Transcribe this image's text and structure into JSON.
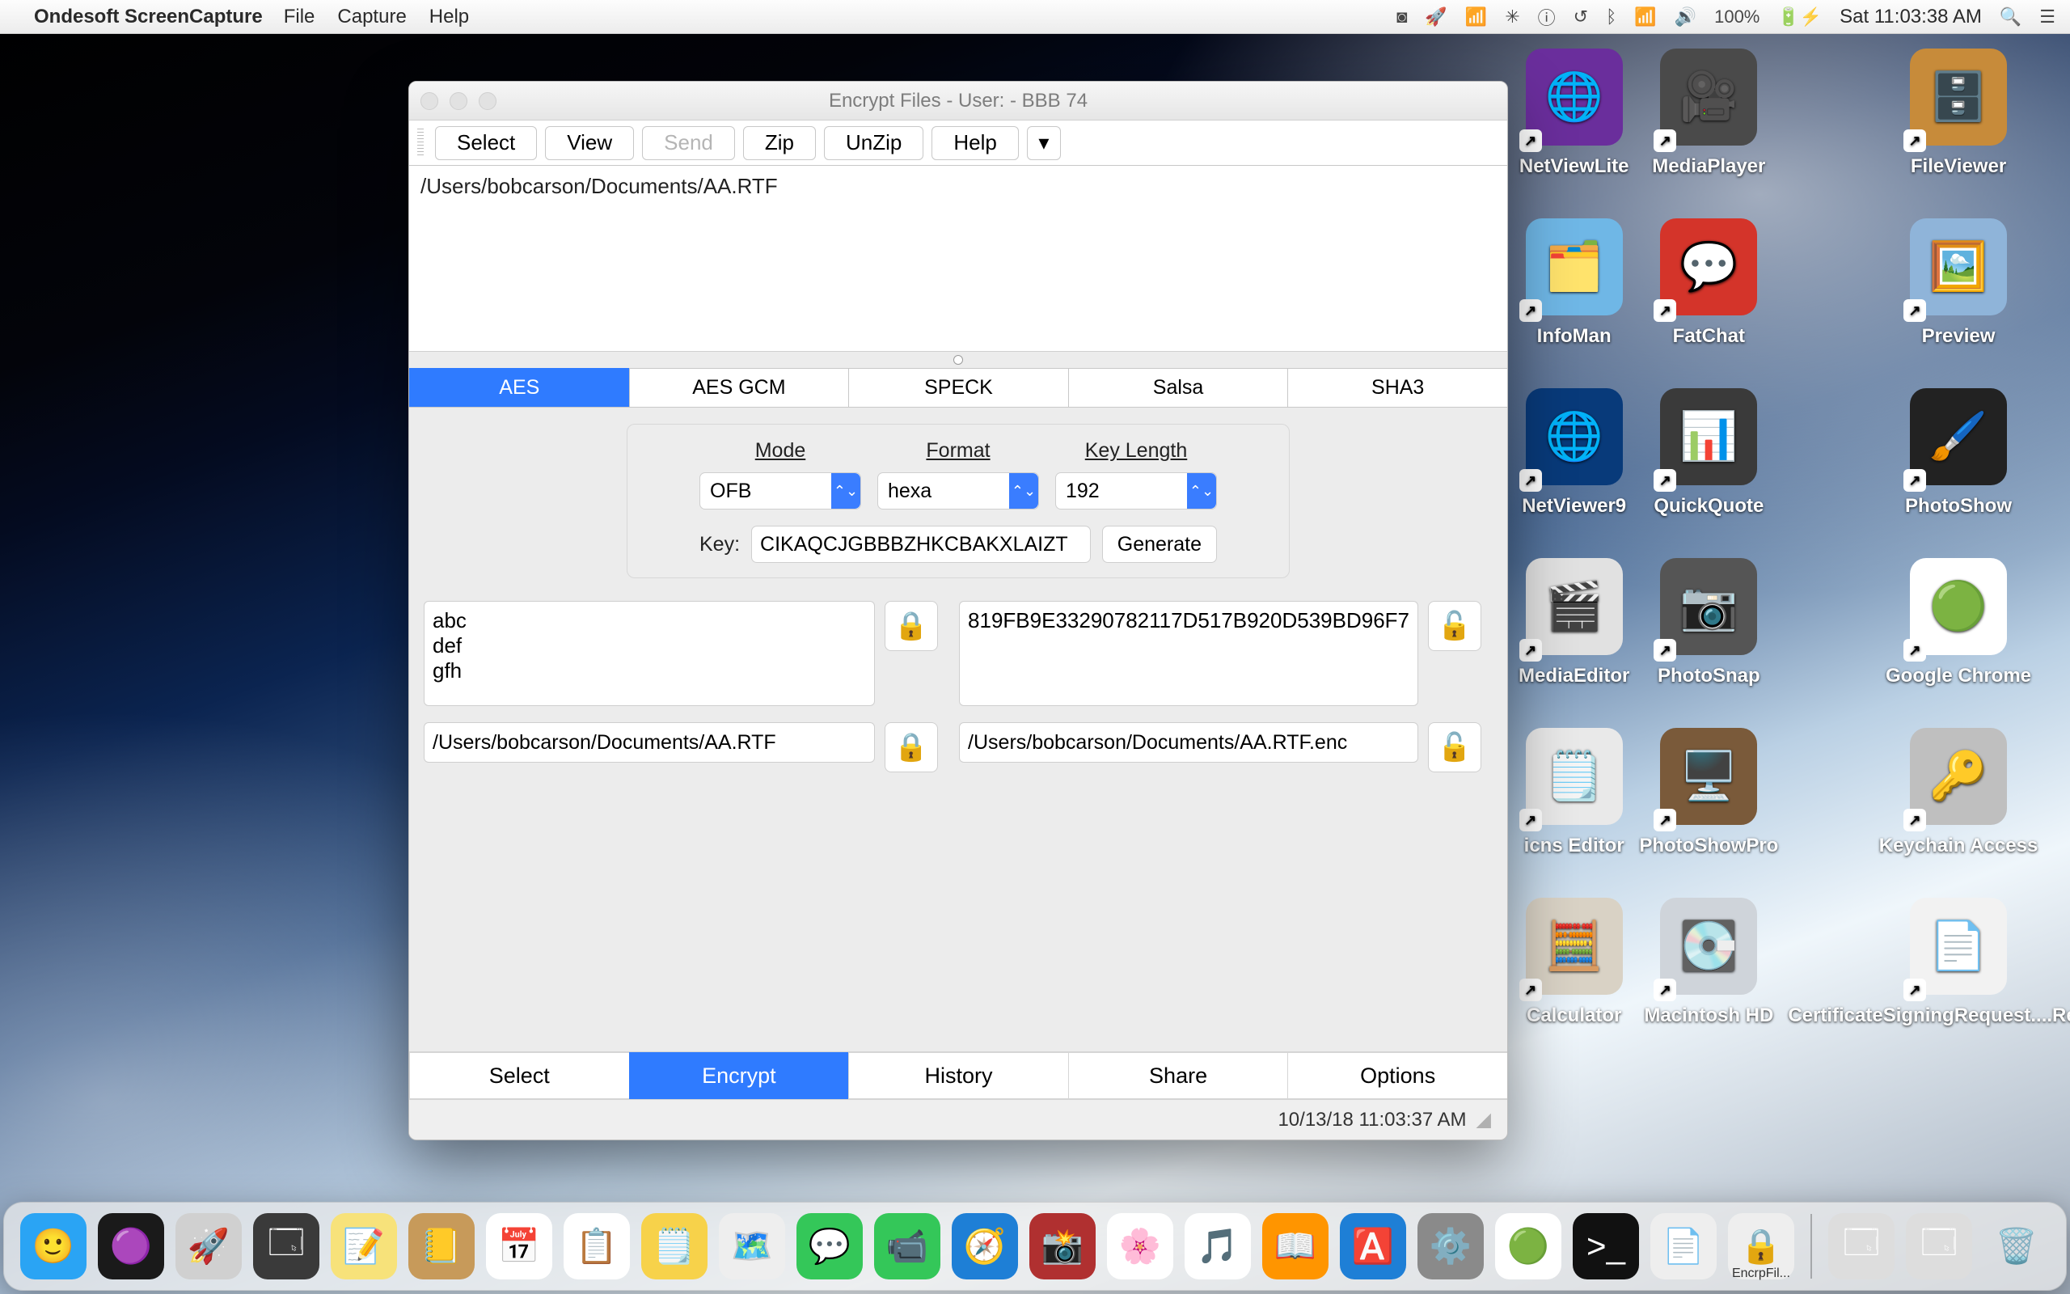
{
  "menubar": {
    "app_name": "Ondesoft ScreenCapture",
    "items": [
      "File",
      "Capture",
      "Help"
    ],
    "battery": "100%",
    "clock": "Sat 11:03:38 AM"
  },
  "desktop_icons": [
    {
      "label": "NetViewLite",
      "emoji": "🌐",
      "bg": "#6a2e9c"
    },
    {
      "label": "MediaPlayer",
      "emoji": "🎥",
      "bg": "#4a4a4a"
    },
    {
      "label": "FileViewer",
      "emoji": "🗄️",
      "bg": "#c78b3a"
    },
    {
      "label": "InfoMan",
      "emoji": "🗂️",
      "bg": "#6fb7e6"
    },
    {
      "label": "FatChat",
      "emoji": "💬",
      "bg": "#d4342a"
    },
    {
      "label": "Preview",
      "emoji": "🖼️",
      "bg": "#8fb4d9"
    },
    {
      "label": "NetViewer9",
      "emoji": "🌐",
      "bg": "#083a7a"
    },
    {
      "label": "QuickQuote",
      "emoji": "📊",
      "bg": "#3a3a3a"
    },
    {
      "label": "PhotoShow",
      "emoji": "🖌️",
      "bg": "#222222"
    },
    {
      "label": "MediaEditor",
      "emoji": "🎬",
      "bg": "#e1e1e1"
    },
    {
      "label": "PhotoSnap",
      "emoji": "📷",
      "bg": "#555555"
    },
    {
      "label": "Google Chrome",
      "emoji": "🟢",
      "bg": "#ffffff"
    },
    {
      "label": "icns Editor",
      "emoji": "🗒️",
      "bg": "#e9e9e9"
    },
    {
      "label": "PhotoShowPro",
      "emoji": "🖥️",
      "bg": "#7a5a3a"
    },
    {
      "label": "Keychain Access",
      "emoji": "🔑",
      "bg": "#bfbfbf"
    },
    {
      "label": "Calculator",
      "emoji": "🧮",
      "bg": "#d9d2c5"
    },
    {
      "label": "Macintosh HD",
      "emoji": "💽",
      "bg": "#cfd4da"
    },
    {
      "label": "CertificateSigningRequest....Request",
      "emoji": "📄",
      "bg": "#f2f2f2"
    }
  ],
  "window": {
    "title": "Encrypt Files - User:  - BBB 74",
    "toolbar": {
      "select": "Select",
      "view": "View",
      "send": "Send",
      "zip": "Zip",
      "unzip": "UnZip",
      "help": "Help"
    },
    "filelist": "/Users/bobcarson/Documents/AA.RTF",
    "tabs": [
      "AES",
      "AES GCM",
      "SPECK",
      "Salsa",
      "SHA3"
    ],
    "active_tab": 0,
    "params": {
      "mode_label": "Mode",
      "format_label": "Format",
      "keylen_label": "Key Length",
      "mode": "OFB",
      "format": "hexa",
      "keylen": "192",
      "key_label": "Key:",
      "key_value": "CIKAQCJGBBBZHKCBAKXLAIZT",
      "generate": "Generate"
    },
    "plaintext": "abc\ndef\ngfh",
    "ciphertext": "819FB9E33290782117D517B920D539BD96F7",
    "in_path": "/Users/bobcarson/Documents/AA.RTF",
    "out_path": "/Users/bobcarson/Documents/AA.RTF.enc",
    "bottom_tabs": [
      "Select",
      "Encrypt",
      "History",
      "Share",
      "Options"
    ],
    "bottom_active": 1,
    "status_time": "10/13/18 11:03:37 AM"
  },
  "dock": {
    "items": [
      {
        "name": "finder",
        "emoji": "🙂",
        "bg": "#2aa4f4"
      },
      {
        "name": "siri",
        "emoji": "🟣",
        "bg": "#1a1a1a"
      },
      {
        "name": "launchpad",
        "emoji": "🚀",
        "bg": "#d0d0d0"
      },
      {
        "name": "mission-control",
        "emoji": "🗔",
        "bg": "#3a3a3a"
      },
      {
        "name": "notes",
        "emoji": "📝",
        "bg": "#f7e27a"
      },
      {
        "name": "contacts",
        "emoji": "📒",
        "bg": "#c79a5a"
      },
      {
        "name": "calendar",
        "emoji": "📅",
        "bg": "#ffffff"
      },
      {
        "name": "reminders",
        "emoji": "📋",
        "bg": "#ffffff"
      },
      {
        "name": "stickies",
        "emoji": "🗒️",
        "bg": "#f7d24a"
      },
      {
        "name": "maps",
        "emoji": "🗺️",
        "bg": "#eeeeee"
      },
      {
        "name": "messages",
        "emoji": "💬",
        "bg": "#34c759"
      },
      {
        "name": "facetime",
        "emoji": "📹",
        "bg": "#34c759"
      },
      {
        "name": "safari",
        "emoji": "🧭",
        "bg": "#1e7fd6"
      },
      {
        "name": "photobooth",
        "emoji": "📸",
        "bg": "#b03030"
      },
      {
        "name": "photos",
        "emoji": "🌸",
        "bg": "#ffffff"
      },
      {
        "name": "itunes",
        "emoji": "🎵",
        "bg": "#ffffff"
      },
      {
        "name": "ibooks",
        "emoji": "📖",
        "bg": "#ff9500"
      },
      {
        "name": "appstore",
        "emoji": "🅰️",
        "bg": "#1e7fd6"
      },
      {
        "name": "preferences",
        "emoji": "⚙️",
        "bg": "#8a8a8a"
      },
      {
        "name": "chrome",
        "emoji": "🟢",
        "bg": "#ffffff"
      },
      {
        "name": "terminal",
        "emoji": ">_",
        "bg": "#111111"
      },
      {
        "name": "textedit",
        "emoji": "📄",
        "bg": "#eeeeee"
      },
      {
        "name": "encrypt-app",
        "emoji": "🔒",
        "bg": "#eeeeee"
      }
    ],
    "right": [
      {
        "name": "doc1",
        "emoji": "🗔",
        "bg": "#dddddd"
      },
      {
        "name": "doc2",
        "emoji": "🗔",
        "bg": "#dddddd"
      },
      {
        "name": "trash",
        "emoji": "🗑️",
        "bg": "transparent"
      }
    ],
    "running_label": "EncrpFil..."
  }
}
